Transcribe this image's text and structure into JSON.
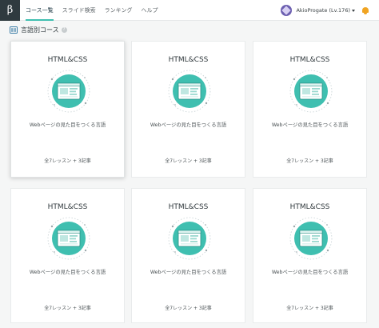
{
  "app": {
    "logo_glyph": "β"
  },
  "nav": {
    "items": [
      {
        "label": "コース一覧",
        "active": true
      },
      {
        "label": "スライド検索",
        "active": false
      },
      {
        "label": "ランキング",
        "active": false
      },
      {
        "label": "ヘルプ",
        "active": false
      }
    ]
  },
  "user": {
    "name": "AkioProgate (Lv.176)"
  },
  "section": {
    "title": "言語別コース"
  },
  "cards": [
    {
      "title": "HTML&CSS",
      "description": "Webページの見た目をつくる言語",
      "meta": "全7レッスン + 3記事"
    },
    {
      "title": "HTML&CSS",
      "description": "Webページの見た目をつくる言語",
      "meta": "全7レッスン + 3記事"
    },
    {
      "title": "HTML&CSS",
      "description": "Webページの見た目をつくる言語",
      "meta": "全7レッスン + 3記事"
    },
    {
      "title": "HTML&CSS",
      "description": "Webページの見た目をつくる言語",
      "meta": "全7レッスン + 3記事"
    },
    {
      "title": "HTML&CSS",
      "description": "Webページの見た目をつくる言語",
      "meta": "全7レッスン + 3記事"
    },
    {
      "title": "HTML&CSS",
      "description": "Webページの見た目をつくる言語",
      "meta": "全7レッスン + 3記事"
    }
  ],
  "colors": {
    "accent": "#3fbfb0",
    "topbar_bg": "#ffffff",
    "page_bg": "#f5f6f6",
    "logo_bg": "#2f3a3f",
    "bell": "#f0a422"
  },
  "icons": [
    "beta-logo",
    "avatar",
    "caret-down-icon",
    "bell-icon",
    "course-list-icon",
    "info-icon",
    "html-css-illustration"
  ]
}
